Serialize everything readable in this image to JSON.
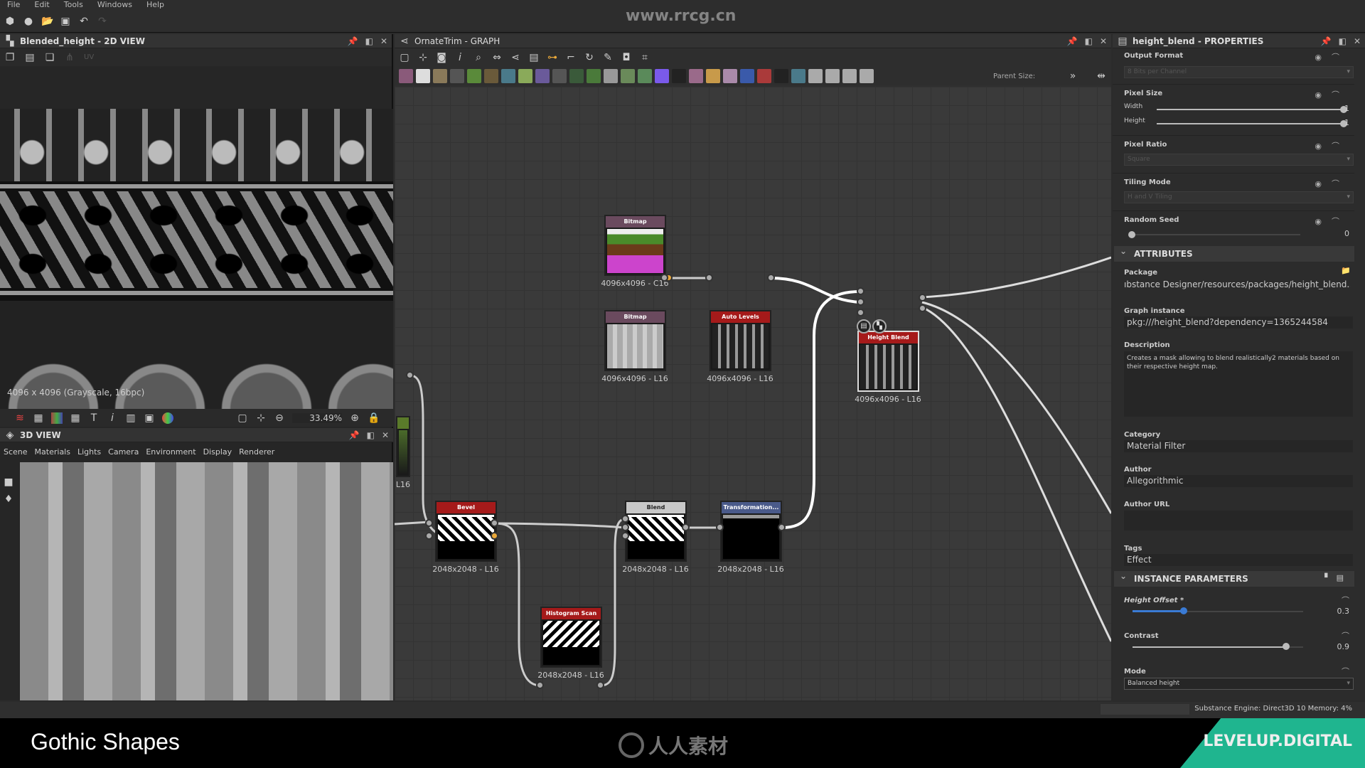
{
  "menu": [
    "File",
    "Edit",
    "Tools",
    "Windows",
    "Help"
  ],
  "watermark": "www.rrcg.cn",
  "view2d": {
    "title": "Blended_height - 2D VIEW",
    "uv_label": "UV",
    "info": "4096 x 4096 (Grayscale, 16bpc)",
    "zoom": "33.49%"
  },
  "view3d": {
    "title": "3D VIEW",
    "menu": [
      "Scene",
      "Materials",
      "Lights",
      "Camera",
      "Environment",
      "Display",
      "Renderer"
    ]
  },
  "graph": {
    "title": "OrnateTrim - GRAPH",
    "parent_size_label": "Parent Size:",
    "toolbar_colors": [
      "#8a5a7a",
      "#ddd",
      "#8a7a5a",
      "#555",
      "#5a8a3a",
      "#6a5a3a",
      "#4a7a8a",
      "#8aa a5a",
      "#6a5a9a",
      "#555",
      "#3a5a3a",
      "#4a7a3a",
      "#999",
      "#6a8a5a",
      "#5a8a5a",
      "#7a5aea",
      "#222",
      "#9a6a8a",
      "#c89a4a",
      "#aa8aaa",
      "#3a5aaa",
      "#aa3a3a",
      "#222",
      "#4a7a8a",
      "#aaa",
      "#aaa",
      "#aaa",
      "#aaa"
    ],
    "nodes": [
      {
        "title": "Bitmap",
        "label": "4096x4096 - C16",
        "color": "#6a4a5e"
      },
      {
        "title": "Bitmap",
        "label": "4096x4096 - L16",
        "color": "#6a4a5e"
      },
      {
        "title": "Auto Levels",
        "label": "4096x4096 - L16",
        "color": "#a51a1a"
      },
      {
        "title": "Height Blend",
        "label": "4096x4096 - L16",
        "color": "#a51a1a"
      },
      {
        "title": "Bevel",
        "label": "2048x2048 - L16",
        "color": "#a51a1a"
      },
      {
        "title": "Blend",
        "label": "2048x2048 - L16",
        "color": "#c8c8c8"
      },
      {
        "title": "Transformation...",
        "label": "2048x2048 - L16",
        "color": "#4a5a8a"
      },
      {
        "title": "Histogram Scan",
        "label": "2048x2048 - L16",
        "color": "#a51a1a"
      },
      {
        "title": "",
        "label": "L16",
        "color": "#5a7a2a"
      }
    ]
  },
  "props": {
    "title": "height_blend - PROPERTIES",
    "output_format": {
      "label": "Output Format",
      "value": "8 Bits per Channel"
    },
    "pixel_size": {
      "label": "Pixel Size",
      "width_label": "Width",
      "width": "1",
      "height_label": "Height",
      "height": "1"
    },
    "pixel_ratio": {
      "label": "Pixel Ratio",
      "value": "Square"
    },
    "tiling_mode": {
      "label": "Tiling Mode",
      "value": "H and V Tiling"
    },
    "random_seed": {
      "label": "Random Seed",
      "value": "0"
    },
    "attributes": {
      "header": "ATTRIBUTES",
      "package_label": "Package",
      "package": "ıbstance Designer/resources/packages/height_blend.sbs",
      "graph_instance_label": "Graph instance",
      "graph_instance": "pkg:///height_blend?dependency=1365244584",
      "description_label": "Description",
      "description": "Creates a mask allowing to blend realistically2 materials based on their respective height map.",
      "category_label": "Category",
      "category": "Material Filter",
      "author_label": "Author",
      "author": "Allegorithmic",
      "author_url_label": "Author URL",
      "author_url": "",
      "tags_label": "Tags",
      "tags": "Effect"
    },
    "instance": {
      "header": "INSTANCE PARAMETERS",
      "height_offset_label": "Height Offset *",
      "height_offset": "0.3",
      "height_offset_fraction": 0.3,
      "contrast_label": "Contrast",
      "contrast": "0.9",
      "contrast_fraction": 0.9,
      "mode_label": "Mode",
      "mode": "Balanced height"
    }
  },
  "status": "Substance Engine: Direct3D 10  Memory: 4%",
  "footer": {
    "title": "Gothic Shapes",
    "center_logo": "人人素材",
    "brand": "LEVELUP.DIGITAL",
    "brand_color": "#1fb58f"
  }
}
